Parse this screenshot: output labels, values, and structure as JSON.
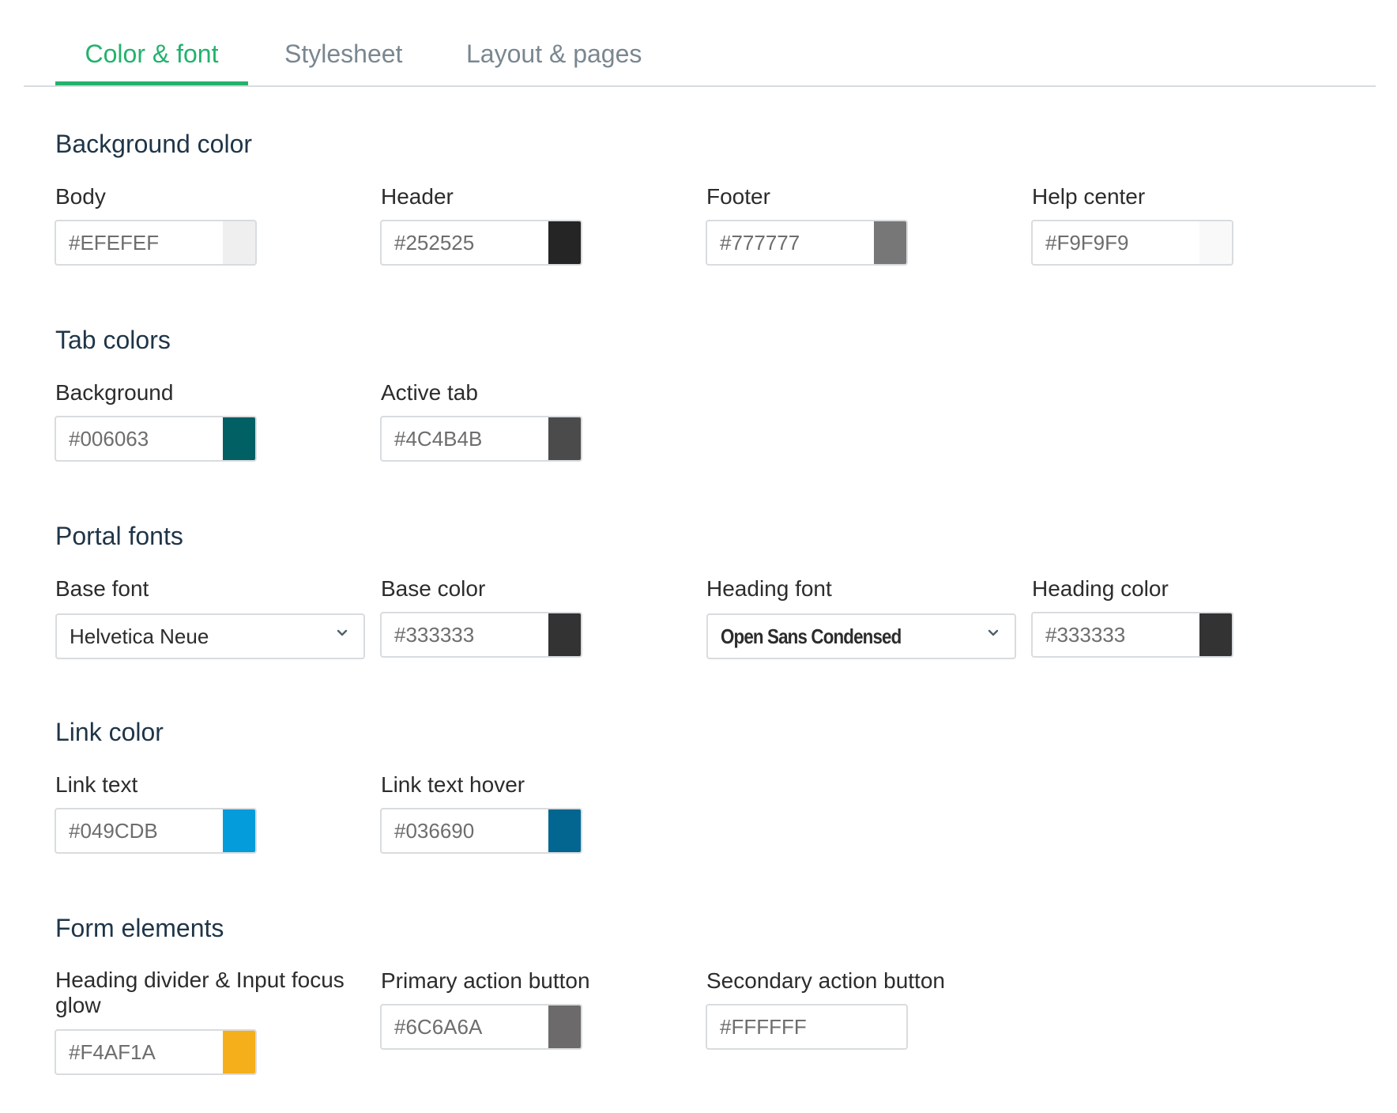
{
  "tabs": [
    {
      "label": "Color & font",
      "active": true
    },
    {
      "label": "Stylesheet",
      "active": false
    },
    {
      "label": "Layout & pages",
      "active": false
    }
  ],
  "sections": {
    "background_color": {
      "title": "Background color",
      "fields": [
        {
          "label": "Body",
          "value": "#EFEFEF",
          "swatch": "#EFEFEF"
        },
        {
          "label": "Header",
          "value": "#252525",
          "swatch": "#252525"
        },
        {
          "label": "Footer",
          "value": "#777777",
          "swatch": "#777777"
        },
        {
          "label": "Help center",
          "value": "#F9F9F9",
          "swatch": "#F9F9F9"
        }
      ]
    },
    "tab_colors": {
      "title": "Tab colors",
      "fields": [
        {
          "label": "Background",
          "value": "#006063",
          "swatch": "#006063"
        },
        {
          "label": "Active tab",
          "value": "#4C4B4B",
          "swatch": "#4C4B4B"
        }
      ]
    },
    "portal_fonts": {
      "title": "Portal fonts",
      "base_font": {
        "label": "Base font",
        "value": "Helvetica Neue"
      },
      "base_color": {
        "label": "Base color",
        "value": "#333333",
        "swatch": "#333333"
      },
      "heading_font": {
        "label": "Heading font",
        "value": "Open Sans Condensed"
      },
      "heading_color": {
        "label": "Heading color",
        "value": "#333333",
        "swatch": "#333333"
      }
    },
    "link_color": {
      "title": "Link color",
      "fields": [
        {
          "label": "Link text",
          "value": "#049CDB",
          "swatch": "#049CDB"
        },
        {
          "label": "Link text hover",
          "value": "#036690",
          "swatch": "#036690"
        }
      ]
    },
    "form_elements": {
      "title": "Form elements",
      "fields": [
        {
          "label": "Heading divider & Input focus glow",
          "value": "#F4AF1A",
          "swatch": "#F4AF1A"
        },
        {
          "label": "Primary action button",
          "value": "#6C6A6A",
          "swatch": "#6C6A6A"
        },
        {
          "label": "Secondary action button",
          "value": "#FFFFFF",
          "swatch": "#FFFFFF"
        }
      ]
    }
  },
  "colors": {
    "accent": "#23B26D",
    "heading_text": "#1F3548",
    "tab_inactive_text": "#7A8790",
    "border": "#D9DCDE"
  },
  "icons": {
    "select_arrow": "chevron-down-icon"
  }
}
